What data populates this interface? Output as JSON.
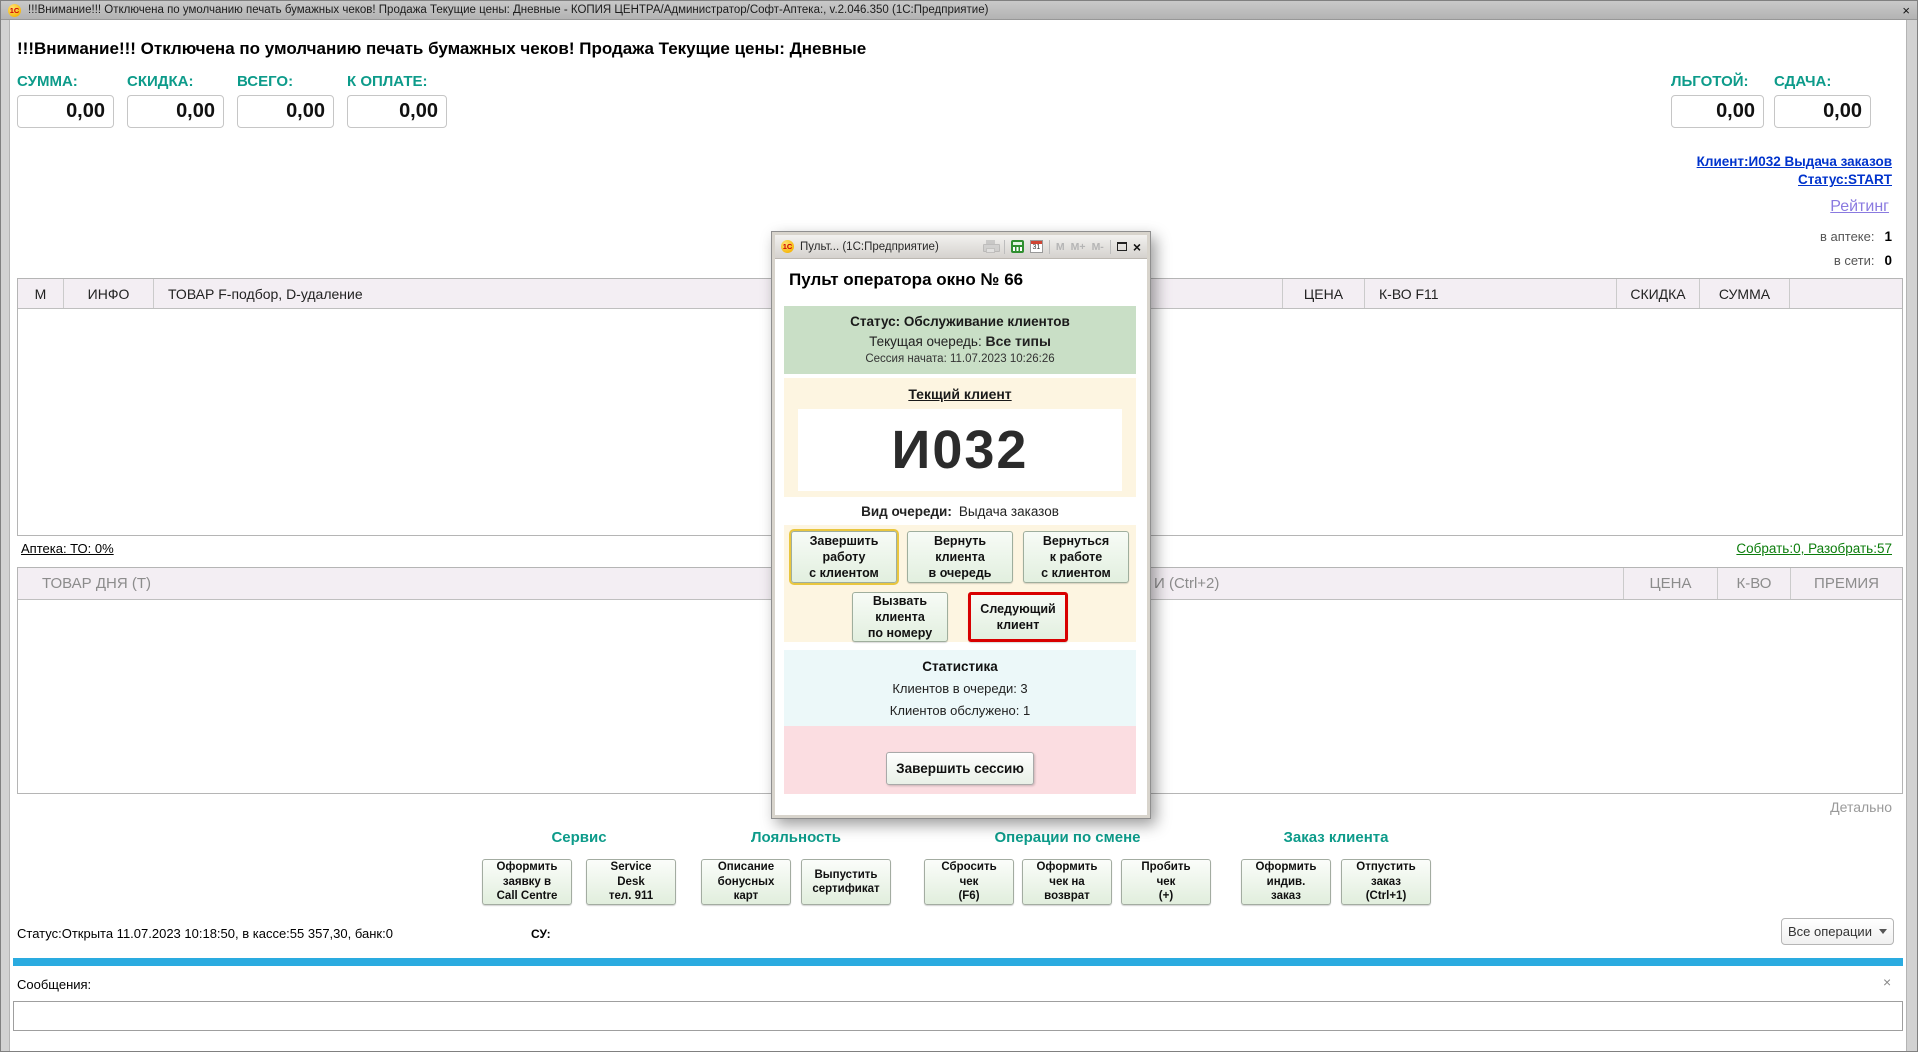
{
  "window": {
    "logo": "1С",
    "title": "!!!Внимание!!! Отключена по умолчанию печать бумажных чеков! Продажа Текущие цены: Дневные - КОПИЯ ЦЕНТРА/Администратор/Софт-Аптека:, v.2.046.350  (1С:Предприятие)",
    "close": "×"
  },
  "warning": "!!!Внимание!!! Отключена по умолчанию печать бумажных чеков! Продажа Текущие цены: Дневные",
  "totals": {
    "sum_label": "СУММА:",
    "sum_value": "0,00",
    "discount_label": "СКИДКА:",
    "discount_value": "0,00",
    "total_label": "ВСЕГО:",
    "total_value": "0,00",
    "to_pay_label": "К ОПЛАТЕ:",
    "to_pay_value": "0,00",
    "privilege_label": "ЛЬГОТОЙ:",
    "privilege_value": "0,00",
    "change_label": "СДАЧА:",
    "change_value": "0,00"
  },
  "client_links": {
    "client": "Клиент:И032 Выдача заказов",
    "status": "Статус:START",
    "rating": "Рейтинг",
    "in_pharmacy_label": "в аптеке:",
    "in_pharmacy_value": "1",
    "in_network_label": "в сети:",
    "in_network_value": "0"
  },
  "table1": {
    "headers": {
      "m": "М",
      "info": "ИНФО",
      "tovar": "ТОВАР  F-подбор, D-удаление",
      "price": "ЦЕНА",
      "qty": "К-ВО F11",
      "discount": "СКИДКА",
      "sum": "СУММА"
    }
  },
  "pharmacy_line": {
    "left": "Аптека: ТО: 0%",
    "right": "Собрать:0, Разобрать:57"
  },
  "table2": {
    "headers": {
      "tovar": "ТОВАР ДНЯ (Т)",
      "i": "И (Ctrl+2)",
      "price": "ЦЕНА",
      "qty": "К-ВО",
      "bonus": "ПРЕМИЯ"
    },
    "detail": "Детально"
  },
  "dialog": {
    "titlebar": {
      "title": "Пульт...  (1С:Предприятие)",
      "m": "M",
      "m_plus": "M+",
      "m_minus": "M-",
      "calendar": "31",
      "close": "×"
    },
    "heading": "Пульт оператора окно № 66",
    "status_box": {
      "status": "Статус: Обслуживание клиентов",
      "queue_label": "Текущая очередь:",
      "queue_value": "Все типы",
      "session_label": "Сессия начата:",
      "session_value": "11.07.2023 10:26:26"
    },
    "client_box": {
      "title": "Текщий клиент",
      "number": "И032"
    },
    "queue_kind": {
      "label": "Вид очереди:",
      "value": "Выдача заказов"
    },
    "buttons": {
      "finish_client": "Завершить\nработу\nс клиентом",
      "return_client": "Вернуть\nклиента\nв очередь",
      "resume_client": "Вернуться\nк работе\nс клиентом",
      "call_by_number": "Вызвать\nклиента\nпо номеру",
      "next_client": "Следующий\nклиент",
      "end_session": "Завершить сессию"
    },
    "stats": {
      "title": "Статистика",
      "in_queue": "Клиентов в очереди: 3",
      "served": "Клиентов обслужено: 1"
    }
  },
  "sections": [
    {
      "title": "Сервис",
      "buttons": [
        "Оформить\nзаявку в\nCall Centre",
        "Service\nDesk\nтел. 911"
      ]
    },
    {
      "title": "Лояльность",
      "buttons": [
        "Описание\nбонусных\nкарт",
        "Выпустить\nсертификат"
      ]
    },
    {
      "title": "Операции по смене",
      "buttons": [
        "Сбросить\nчек\n(F6)",
        "Оформить\nчек на\nвозврат",
        "Пробить\nчек\n(+)"
      ]
    },
    {
      "title": "Заказ клиента",
      "buttons": [
        "Оформить\nиндив.\nзаказ",
        "Отпустить\nзаказ\n(Ctrl+1)"
      ]
    }
  ],
  "statusbar": {
    "text": "Статус:Открыта 11.07.2023 10:18:50, в кассе:55 357,30, банк:0",
    "su": "СУ:",
    "all_ops": "Все операции"
  },
  "messages": {
    "label": "Сообщения:",
    "close": "×"
  }
}
